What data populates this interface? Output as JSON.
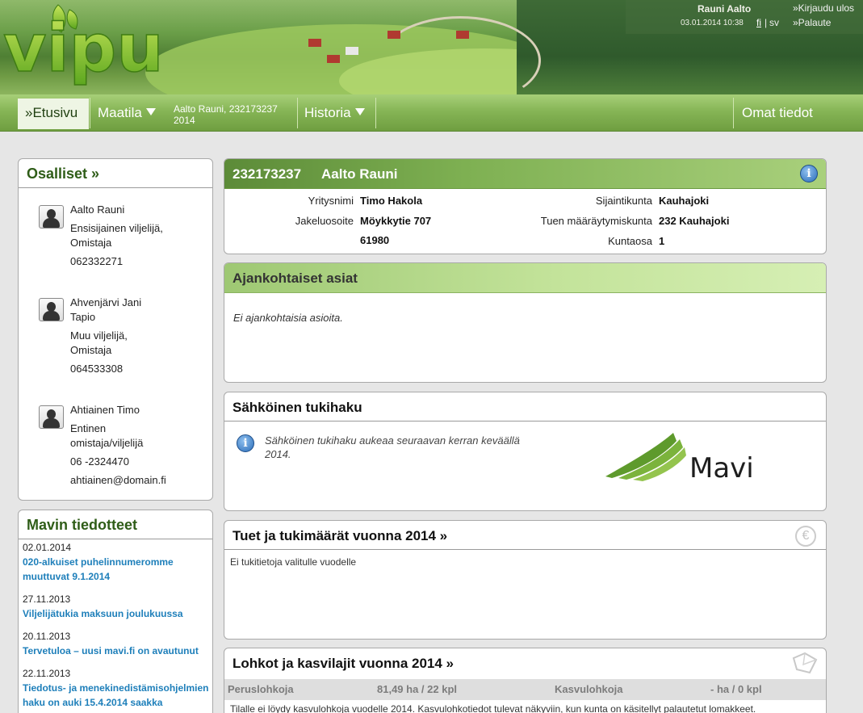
{
  "header": {
    "logo_text": "vipu",
    "user_name": "Rauni Aalto",
    "login_time": "03.01.2014 10:38",
    "lang_fi": "fi",
    "lang_separator": "|",
    "lang_sv": "sv",
    "logout": "»Kirjaudu ulos",
    "feedback": "»Palaute"
  },
  "nav": {
    "home": "»Etusivu",
    "farm": "Maatila",
    "farm_info_line1": "Aalto Rauni, 232173237",
    "farm_info_line2": "2014",
    "history": "Historia",
    "own_info": "Omat tiedot"
  },
  "participants": {
    "title": "Osalliset »",
    "people": [
      {
        "name": "Aalto Rauni",
        "role_line1": "Ensisijainen viljelijä,",
        "role_line2": "Omistaja",
        "phone": "062332271"
      },
      {
        "name_line1": "Ahvenjärvi Jani",
        "name_line2": "Tapio",
        "role_line1": "Muu viljelijä,",
        "role_line2": "Omistaja",
        "phone": "064533308"
      },
      {
        "name": "Ahtiainen Timo",
        "role_line1": "Entinen",
        "role_line2": "omistaja/viljelijä",
        "phone": "06 -2324470",
        "email": "ahtiainen@domain.fi"
      }
    ]
  },
  "bulletins": {
    "title": "Mavin tiedotteet",
    "items": [
      {
        "date": "02.01.2014",
        "line1": "020-alkuiset puhelinnumeromme",
        "line2": "muuttuvat 9.1.2014"
      },
      {
        "date": "27.11.2013",
        "line1": "Viljelijätukia maksuun joulukuussa"
      },
      {
        "date": "20.11.2013",
        "line1": "Tervetuloa – uusi mavi.fi on avautunut"
      },
      {
        "date": "22.11.2013",
        "line1": "Tiedotus- ja menekinedistämisohjelmien",
        "line2": "haku on auki 15.4.2014 saakka"
      }
    ]
  },
  "farm": {
    "id": "232173237",
    "name": "Aalto Rauni",
    "info_icon": "info-icon",
    "company_label": "Yritysnimi",
    "company_value": "Timo Hakola",
    "address_label": "Jakeluosoite",
    "address_value": "Möykkytie 707",
    "postcode_value": "61980",
    "municipality_label": "Sijaintikunta",
    "municipality_value": "Kauhajoki",
    "support_muni_label": "Tuen määräytymiskunta",
    "support_muni_value": "232 Kauhajoki",
    "district_label": "Kuntaosa",
    "district_value": "1"
  },
  "news": {
    "title": "Ajankohtaiset asiat",
    "empty_text": "Ei ajankohtaisia asioita."
  },
  "application": {
    "title": "Sähköinen tukihaku",
    "text_line1": "Sähköinen tukihaku aukeaa seuraavan kerran keväällä",
    "text_line2": "2014.",
    "logo_text": "Mavi"
  },
  "supports": {
    "title": "Tuet ja tukimäärät vuonna 2014 »",
    "empty_text": "Ei tukitietoja valitulle vuodelle",
    "icon": "euro-icon"
  },
  "parcels": {
    "title": "Lohkot ja kasvilajit vuonna 2014 »",
    "col1_label": "Peruslohkoja",
    "col1_value": "81,49 ha / 22 kpl",
    "col2_label": "Kasvulohkoja",
    "col2_value": "- ha / 0 kpl",
    "note": "Tilalle ei löydy kasvulohkoja vuodelle 2014. Kasvulohkotiedot tulevat näkyviin, kun kunta on käsitellyt palautetut lomakkeet."
  },
  "colors": {
    "accent_green": "#2f5d18",
    "link_blue": "#1e7fba",
    "nav_green": "#86b556"
  }
}
